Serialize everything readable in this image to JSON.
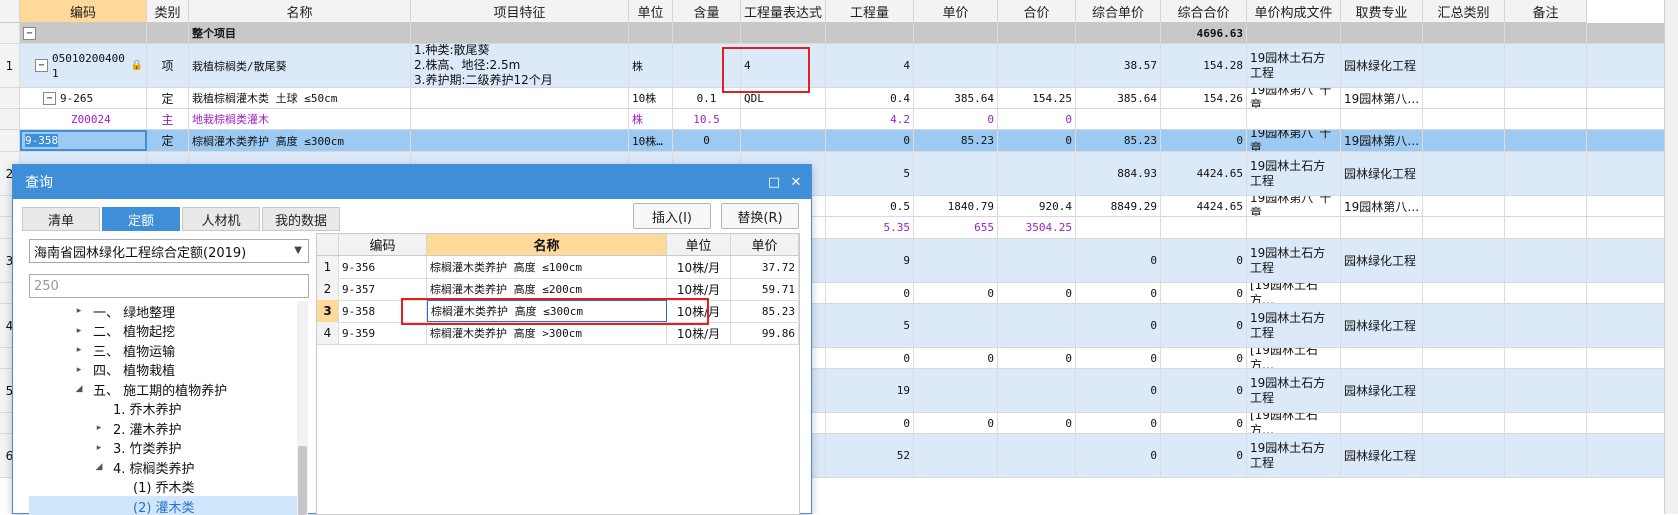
{
  "main_grid": {
    "columns": [
      {
        "key": "code",
        "label": "编码"
      },
      {
        "key": "type",
        "label": "类别"
      },
      {
        "key": "name",
        "label": "名称"
      },
      {
        "key": "feature",
        "label": "项目特征"
      },
      {
        "key": "unit",
        "label": "单位"
      },
      {
        "key": "content",
        "label": "含量"
      },
      {
        "key": "expr",
        "label": "工程量表达式"
      },
      {
        "key": "qty",
        "label": "工程量"
      },
      {
        "key": "price",
        "label": "单价"
      },
      {
        "key": "total",
        "label": "合价"
      },
      {
        "key": "comp_price",
        "label": "综合单价"
      },
      {
        "key": "comp_total",
        "label": "综合合价"
      },
      {
        "key": "price_file",
        "label": "单价构成文件"
      },
      {
        "key": "fee",
        "label": "取费专业"
      },
      {
        "key": "summary",
        "label": "汇总类别"
      },
      {
        "key": "remark",
        "label": "备注"
      }
    ],
    "rows": [
      {
        "id": "all",
        "idx": "",
        "tree": "−",
        "code": "",
        "type": "",
        "name": "整个项目",
        "feature": "",
        "unit": "",
        "content": "",
        "expr": "",
        "qty": "",
        "price": "",
        "total": "",
        "comp_price": "",
        "comp_total": "4696.63",
        "price_file": "",
        "fee": "",
        "summary": "",
        "remark": ""
      },
      {
        "id": "r1",
        "idx": "1",
        "tree": "−",
        "code": "050102004001",
        "type": "项",
        "name": "栽植棕榈类/散尾葵",
        "feature": "1.种类:散尾葵\n2.株高、地径:2.5m\n3.养护期:二级养护12个月",
        "unit": "株",
        "content": "",
        "expr": "4",
        "qty": "4",
        "price": "",
        "total": "",
        "comp_price": "38.57",
        "comp_total": "154.28",
        "price_file": "19园林土石方工程",
        "fee": "园林绿化工程",
        "summary": "",
        "remark": ""
      },
      {
        "id": "r1a",
        "idx": "",
        "tree": "−",
        "code": "9-265",
        "type": "定",
        "name": "栽植棕榈灌木类 土球 ≤50cm",
        "feature": "",
        "unit": "10株",
        "content": "0.1",
        "expr": "QDL",
        "qty": "0.4",
        "price": "385.64",
        "total": "154.25",
        "comp_price": "385.64",
        "comp_total": "154.26",
        "price_file": "19园林第八˜十章",
        "fee": "19园林第八…",
        "summary": "",
        "remark": ""
      },
      {
        "id": "r1b",
        "idx": "",
        "tree": "",
        "code": "Z00024",
        "type": "主",
        "name": "地栽棕榈类灌木",
        "feature": "",
        "unit": "株",
        "content": "10.5",
        "expr": "",
        "qty": "4.2",
        "price": "0",
        "total": "0",
        "comp_price": "",
        "comp_total": "",
        "price_file": "",
        "fee": "",
        "summary": "",
        "remark": ""
      },
      {
        "id": "r1c",
        "idx": "",
        "tree": "",
        "code": "9-358",
        "type": "定",
        "name": "棕榈灌木类养护 高度 ≤300cm",
        "feature": "",
        "unit": "10株…",
        "content": "0",
        "expr": "",
        "qty": "0",
        "price": "85.23",
        "total": "0",
        "comp_price": "85.23",
        "comp_total": "0",
        "price_file": "19园林第八˜十章",
        "fee": "19园林第八…",
        "summary": "",
        "remark": ""
      },
      {
        "id": "r2",
        "idx": "2",
        "tree": "",
        "code": "",
        "type": "",
        "name": "",
        "feature": "",
        "unit": "",
        "content": "",
        "expr": "",
        "qty": "5",
        "price": "",
        "total": "",
        "comp_price": "884.93",
        "comp_total": "4424.65",
        "price_file": "19园林土石方工程",
        "fee": "园林绿化工程",
        "summary": "",
        "remark": ""
      },
      {
        "id": "r2a",
        "idx": "",
        "tree": "",
        "code": "",
        "type": "",
        "name": "",
        "feature": "",
        "unit": "",
        "content": "",
        "expr": "",
        "qty": "0.5",
        "price": "1840.79",
        "total": "920.4",
        "comp_price": "8849.29",
        "comp_total": "4424.65",
        "price_file": "19园林第八˜十章",
        "fee": "19园林第八…",
        "summary": "",
        "remark": ""
      },
      {
        "id": "r2b",
        "idx": "",
        "tree": "",
        "code": "",
        "type": "",
        "name": "",
        "feature": "",
        "unit": "",
        "content": "",
        "expr": "",
        "qty": "5.35",
        "price": "655",
        "total": "3504.25",
        "comp_price": "",
        "comp_total": "",
        "price_file": "",
        "fee": "",
        "summary": "",
        "remark": ""
      },
      {
        "id": "r3",
        "idx": "3",
        "tree": "",
        "code": "",
        "type": "",
        "name": "",
        "feature": "",
        "unit": "",
        "content": "",
        "expr": "",
        "qty": "9",
        "price": "",
        "total": "",
        "comp_price": "0",
        "comp_total": "0",
        "price_file": "19园林土石方工程",
        "fee": "园林绿化工程",
        "summary": "",
        "remark": ""
      },
      {
        "id": "r3a",
        "idx": "",
        "tree": "",
        "code": "",
        "type": "",
        "name": "",
        "feature": "",
        "unit": "",
        "content": "",
        "expr": "",
        "qty": "0",
        "price": "0",
        "total": "0",
        "comp_price": "0",
        "comp_total": "0",
        "price_file": "[19园林土石方…",
        "fee": "",
        "summary": "",
        "remark": ""
      },
      {
        "id": "r4",
        "idx": "4",
        "tree": "",
        "code": "",
        "type": "",
        "name": "",
        "feature": "",
        "unit": "",
        "content": "",
        "expr": "",
        "qty": "5",
        "price": "",
        "total": "",
        "comp_price": "0",
        "comp_total": "0",
        "price_file": "19园林土石方工程",
        "fee": "园林绿化工程",
        "summary": "",
        "remark": ""
      },
      {
        "id": "r4a",
        "idx": "",
        "tree": "",
        "code": "",
        "type": "",
        "name": "",
        "feature": "",
        "unit": "",
        "content": "",
        "expr": "",
        "qty": "0",
        "price": "0",
        "total": "0",
        "comp_price": "0",
        "comp_total": "0",
        "price_file": "[19园林土石方…",
        "fee": "",
        "summary": "",
        "remark": ""
      },
      {
        "id": "r5",
        "idx": "5",
        "tree": "",
        "code": "",
        "type": "",
        "name": "",
        "feature": "",
        "unit": "",
        "content": "",
        "expr": "",
        "qty": "19",
        "price": "",
        "total": "",
        "comp_price": "0",
        "comp_total": "0",
        "price_file": "19园林土石方工程",
        "fee": "园林绿化工程",
        "summary": "",
        "remark": ""
      },
      {
        "id": "r5a",
        "idx": "",
        "tree": "",
        "code": "",
        "type": "",
        "name": "",
        "feature": "",
        "unit": "",
        "content": "",
        "expr": "",
        "qty": "0",
        "price": "0",
        "total": "0",
        "comp_price": "0",
        "comp_total": "0",
        "price_file": "[19园林土石方…",
        "fee": "",
        "summary": "",
        "remark": ""
      },
      {
        "id": "r6",
        "idx": "6",
        "tree": "",
        "code": "",
        "type": "",
        "name": "",
        "feature": "",
        "unit": "",
        "content": "",
        "expr": "",
        "qty": "52",
        "price": "",
        "total": "",
        "comp_price": "0",
        "comp_total": "0",
        "price_file": "19园林土石方工程",
        "fee": "园林绿化工程",
        "summary": "",
        "remark": ""
      }
    ]
  },
  "dialog": {
    "title": "查询",
    "maximize_icon": "□",
    "close_icon": "✕",
    "tabs": [
      "清单",
      "定额",
      "人材机",
      "我的数据"
    ],
    "active_tab": 1,
    "insert_label": "插入(I)",
    "replace_label": "替换(R)",
    "library": "海南省园林绿化工程综合定额(2019)",
    "search_value": "250",
    "tree": [
      {
        "label": "一、 绿地整理",
        "level": 0,
        "arrow": "▸"
      },
      {
        "label": "二、 植物起挖",
        "level": 0,
        "arrow": "▸"
      },
      {
        "label": "三、 植物运输",
        "level": 0,
        "arrow": "▸"
      },
      {
        "label": "四、 植物栽植",
        "level": 0,
        "arrow": "▸"
      },
      {
        "label": "五、 施工期的植物养护",
        "level": 0,
        "arrow": "◢"
      },
      {
        "label": "1. 乔木养护",
        "level": 1,
        "arrow": ""
      },
      {
        "label": "2. 灌木养护",
        "level": 1,
        "arrow": "▸"
      },
      {
        "label": "3. 竹类养护",
        "level": 1,
        "arrow": "▸"
      },
      {
        "label": "4. 棕榈类养护",
        "level": 1,
        "arrow": "◢"
      },
      {
        "label": "(1) 乔木类",
        "level": 2,
        "arrow": ""
      },
      {
        "label": "(2) 灌木类",
        "level": 2,
        "arrow": ""
      }
    ],
    "grid": {
      "headers": [
        "编码",
        "名称",
        "单位",
        "单价"
      ],
      "rows": [
        {
          "idx": "1",
          "code": "9-356",
          "name": "棕榈灌木类养护 高度 ≤100cm",
          "unit": "10株/月",
          "price": "37.72"
        },
        {
          "idx": "2",
          "code": "9-357",
          "name": "棕榈灌木类养护 高度 ≤200cm",
          "unit": "10株/月",
          "price": "59.71"
        },
        {
          "idx": "3",
          "code": "9-358",
          "name": "棕榈灌木类养护 高度 ≤300cm",
          "unit": "10株/月",
          "price": "85.23"
        },
        {
          "idx": "4",
          "code": "9-359",
          "name": "棕榈灌木类养护 高度 >300cm",
          "unit": "10株/月",
          "price": "99.86"
        }
      ],
      "selected_row": 2
    }
  },
  "colors": {
    "accent": "#3f8ed8",
    "highlight_header": "#ffd999",
    "row_blue": "#dce9f9",
    "row_selected": "#9dcaf2",
    "purple_text": "#a020c8",
    "red_box": "#e02020"
  }
}
